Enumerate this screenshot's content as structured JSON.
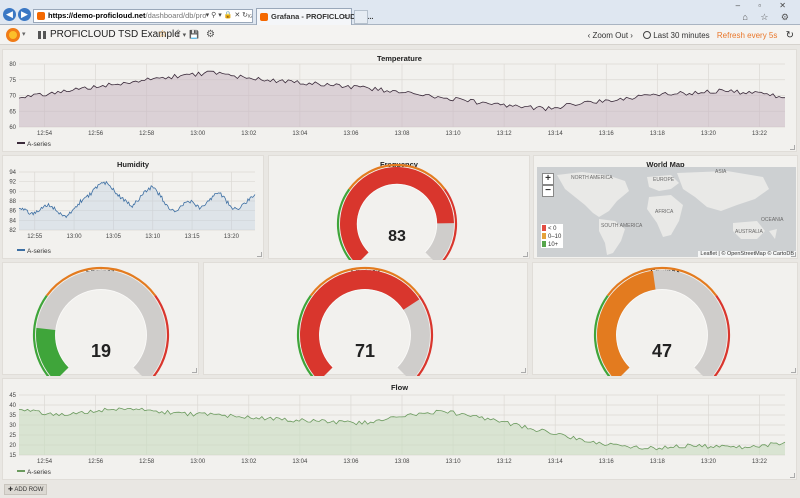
{
  "browser": {
    "url_domain": "https://demo-proficloud.net",
    "url_path": "/dashboard/db/proficloud-tsd-example?r",
    "url_icons": "▾ ⚲ ▾ 🔒 ✕ ↻",
    "tab_title": "Grafana - PROFICLOUD TS...",
    "tab_close": "×",
    "window_buttons": "– ▫ ✕",
    "tool_icons": "⌂ ☆ ⚙",
    "back_icon": "◀",
    "forward_icon": "▶"
  },
  "navbar": {
    "logo_caret": "▾",
    "dashboard_title": "PROFICLOUD TSD Example",
    "dashboard_caret": "▾",
    "star_icon": "☆",
    "share_icon": "⇪",
    "save_icon": "💾",
    "settings_icon": "⚙",
    "zoom_left": "‹",
    "zoom_out": "Zoom Out",
    "zoom_right": "›",
    "time_range": "Last 30 minutes",
    "refresh_label": "Refresh every 5s",
    "refresh_icon": "↻"
  },
  "panels": {
    "temperature": {
      "title": "Temperature",
      "legend": "A-series",
      "color": "#3a2a3a"
    },
    "humidity": {
      "title": "Humidity",
      "legend": "A-series",
      "color": "#3d6fa3"
    },
    "frequency": {
      "title": "Frequency",
      "value": "83"
    },
    "world_map": {
      "title": "World Map",
      "zoom_in": "+",
      "zoom_out": "−",
      "legend": [
        "< 0",
        "0–10",
        "10+"
      ],
      "legend_colors": [
        "#e24d42",
        "#e5a23a",
        "#56a64b"
      ],
      "attribution": "Leaflet | © OpenStreetMap © CartoDB",
      "labels": [
        "NORTH AMERICA",
        "EUROPE",
        "ASIA",
        "AFRICA",
        "SOUTH AMERICA",
        "OCEANIA",
        "AUSTRALIA"
      ]
    },
    "engine1": {
      "title": "Engine1",
      "value": "19"
    },
    "engine2": {
      "title": "Engine2",
      "value": "71"
    },
    "engine3": {
      "title": "Engine3",
      "value": "47"
    },
    "flow": {
      "title": "Flow",
      "legend": "A-series",
      "color": "#6b9a5e"
    }
  },
  "gauge_colors": {
    "green": "#3fa53a",
    "orange": "#e37b1f",
    "red": "#d9362d",
    "track": "#cfcdcb"
  },
  "add_row": "✚ ADD ROW",
  "chart_data": [
    {
      "type": "line",
      "title": "Temperature",
      "series": [
        {
          "name": "A-series",
          "values": [
            69.2,
            69.8,
            70.4,
            70.9,
            71.5,
            72.1,
            72.6,
            73.2,
            73.7,
            74.1,
            74.6,
            75.2,
            75.7,
            76.1,
            76.5,
            76.9,
            77.2,
            76.6,
            76.0,
            75.6,
            75.2,
            74.8,
            74.5,
            74.3,
            74.0,
            73.6,
            73.2,
            72.9,
            72.6,
            72.3,
            71.9,
            71.5,
            71.1,
            70.6,
            70.1,
            69.5,
            69.0,
            68.5,
            68.0,
            67.6,
            67.2,
            66.8,
            66.4,
            66.1,
            65.8,
            66.3,
            66.9,
            67.4,
            67.9,
            68.3,
            68.8,
            69.2,
            69.6,
            70.0,
            70.3,
            70.6,
            70.8,
            71.1,
            71.4,
            71.6,
            71.2,
            70.8,
            70.4,
            70.0,
            69.6
          ]
        }
      ],
      "x_start": "12:53",
      "x_end": "13:23",
      "xticks": [
        "12:54",
        "12:56",
        "12:58",
        "13:00",
        "13:02",
        "13:04",
        "13:06",
        "13:08",
        "13:10",
        "13:12",
        "13:14",
        "13:16",
        "13:18",
        "13:20",
        "13:22"
      ],
      "yticks": [
        60,
        65,
        70,
        75,
        80
      ],
      "ylim": [
        60,
        80
      ],
      "grid": true,
      "legend": "bottom-left"
    },
    {
      "type": "line",
      "title": "Humidity",
      "series": [
        {
          "name": "A-series",
          "values": [
            86.5,
            86.2,
            85.7,
            85.4,
            85.9,
            86.6,
            87.3,
            86.9,
            86.0,
            85.3,
            84.8,
            85.6,
            86.8,
            87.9,
            88.6,
            89.4,
            90.3,
            91.2,
            91.8,
            91.4,
            90.3,
            89.2,
            88.4,
            87.6,
            87.1,
            87.9,
            89.1,
            90.1,
            90.8,
            90.2,
            89.0,
            87.5,
            86.3,
            85.8,
            86.5,
            87.6,
            88.1,
            87.4,
            86.6,
            86.9,
            87.8,
            88.9,
            89.7,
            89.2,
            87.9,
            86.8,
            86.1,
            86.7,
            87.6,
            88.6,
            89.5
          ]
        }
      ],
      "x_start": "12:53",
      "x_end": "13:23",
      "xticks": [
        "12:55",
        "13:00",
        "13:05",
        "13:10",
        "13:15",
        "13:20"
      ],
      "yticks": [
        82,
        84,
        86,
        88,
        90,
        92,
        94
      ],
      "ylim": [
        82,
        94
      ],
      "grid": true,
      "legend": "bottom-left"
    },
    {
      "type": "area",
      "title": "Flow",
      "series": [
        {
          "name": "A-series",
          "values": [
            37.8,
            37.0,
            36.2,
            35.4,
            35.1,
            35.8,
            36.6,
            37.3,
            38.0,
            38.4,
            38.1,
            37.5,
            36.9,
            36.4,
            36.0,
            35.6,
            35.2,
            34.9,
            34.6,
            34.2,
            33.8,
            33.5,
            33.1,
            32.8,
            32.5,
            32.2,
            31.9,
            31.6,
            31.3,
            31.1,
            30.9,
            31.8,
            32.9,
            34.0,
            34.9,
            35.7,
            36.3,
            36.5,
            36.0,
            35.2,
            34.2,
            33.1,
            31.9,
            30.6,
            29.3,
            27.9,
            26.6,
            25.3,
            24.1,
            22.9,
            21.8,
            20.7,
            19.8,
            19.0,
            18.5,
            18.3,
            18.7,
            19.2,
            19.6,
            19.8,
            19.5,
            19.1,
            18.6,
            18.9,
            19.4,
            19.9,
            20.5,
            21.2
          ]
        }
      ],
      "x_start": "12:53",
      "x_end": "13:23",
      "xticks": [
        "12:54",
        "12:56",
        "12:58",
        "13:00",
        "13:02",
        "13:04",
        "13:06",
        "13:08",
        "13:10",
        "13:12",
        "13:14",
        "13:16",
        "13:18",
        "13:20",
        "13:22"
      ],
      "yticks": [
        15,
        20,
        25,
        30,
        35,
        40,
        45
      ],
      "ylim": [
        15,
        45
      ],
      "grid": true,
      "legend": "bottom-left"
    }
  ]
}
